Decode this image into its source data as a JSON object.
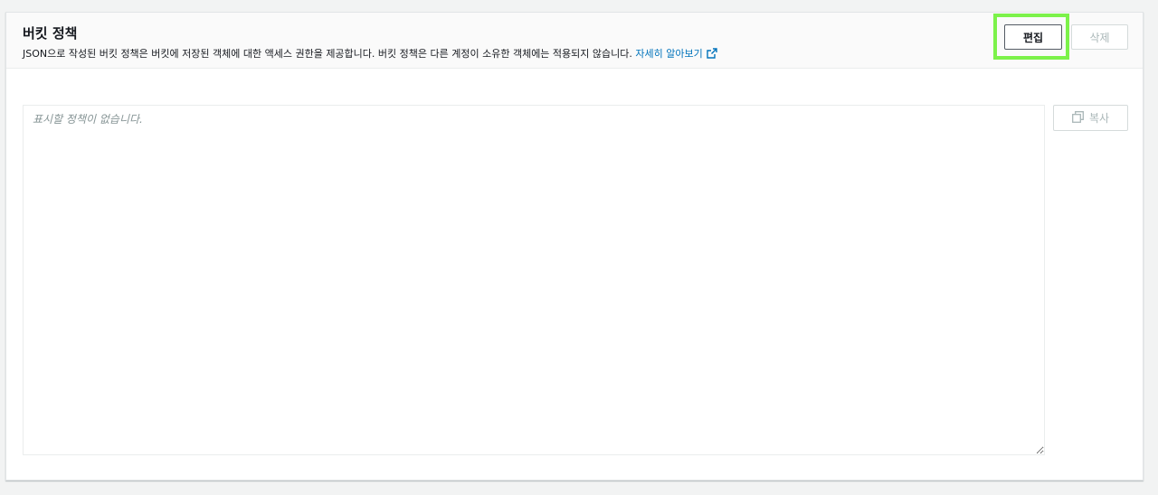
{
  "header": {
    "title": "버킷 정책",
    "description": "JSON으로 작성된 버킷 정책은 버킷에 저장된 객체에 대한 액세스 권한을 제공합니다. 버킷 정책은 다른 계정이 소유한 객체에는 적용되지 않습니다.",
    "learn_more": "자세히 알아보기"
  },
  "actions": {
    "edit_label": "편집",
    "delete_label": "삭제"
  },
  "editor": {
    "placeholder": "표시할 정책이 없습니다."
  },
  "copy_label": "복사",
  "colors": {
    "accent_link": "#0073bb",
    "highlight": "#7cf24a"
  }
}
